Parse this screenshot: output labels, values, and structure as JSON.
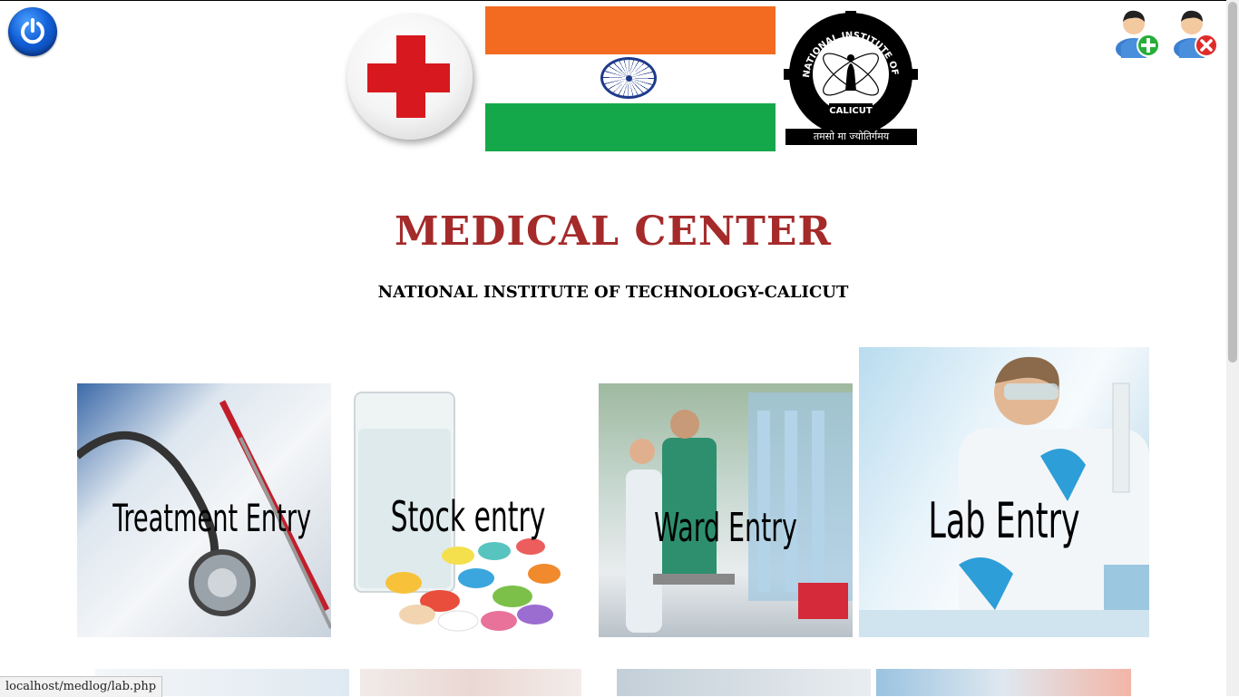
{
  "header": {
    "power_icon": "power-icon",
    "add_user_icon": "add-user-icon",
    "remove_user_icon": "remove-user-icon",
    "nit_logo_text": "NATIONAL INSTITUTE OF TECHNOLOGY",
    "nit_logo_city": "CALICUT",
    "nit_motto": "तमसो मा ज्योतिर्गमय"
  },
  "main": {
    "title": "MEDICAL CENTER",
    "subtitle": "NATIONAL INSTITUTE OF TECHNOLOGY-CALICUT",
    "tiles": [
      {
        "label": "Treatment Entry"
      },
      {
        "label": "Stock entry"
      },
      {
        "label": "Ward Entry"
      },
      {
        "label": "Lab Entry"
      }
    ]
  },
  "status_bar": {
    "url": "localhost/medlog/lab.php"
  },
  "colors": {
    "title": "#a52a2a",
    "power_button": "#1260d8",
    "red_cross": "#d7191f",
    "saffron": "#f26b21",
    "green": "#15a84a"
  }
}
